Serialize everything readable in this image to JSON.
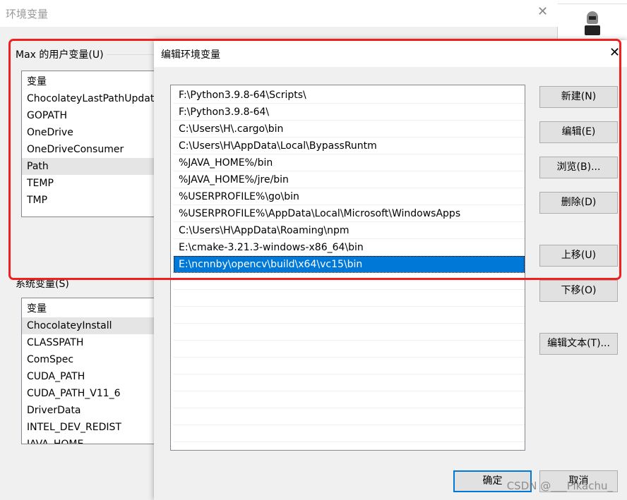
{
  "background_window": {
    "title": "环境变量",
    "user_group": "Max 的用户变量(U)",
    "user_header": "变量",
    "user_vars": [
      "ChocolateyLastPathUpdate",
      "GOPATH",
      "OneDrive",
      "OneDriveConsumer",
      "Path",
      "TEMP",
      "TMP"
    ],
    "system_group": "系统变量(S)",
    "system_header": "变量",
    "system_vars": [
      "ChocolateyInstall",
      "CLASSPATH",
      "ComSpec",
      "CUDA_PATH",
      "CUDA_PATH_V11_6",
      "DriverData",
      "INTEL_DEV_REDIST",
      "JAVA_HOME"
    ]
  },
  "dialog": {
    "title": "编辑环境变量",
    "paths": [
      "F:\\Python3.9.8-64\\Scripts\\",
      "F:\\Python3.9.8-64\\",
      "C:\\Users\\H\\.cargo\\bin",
      "C:\\Users\\H\\AppData\\Local\\BypassRuntm",
      "%JAVA_HOME%/bin",
      "%JAVA_HOME%/jre/bin",
      "%USERPROFILE%\\go\\bin",
      "%USERPROFILE%\\AppData\\Local\\Microsoft\\WindowsApps",
      "C:\\Users\\H\\AppData\\Roaming\\npm",
      "E:\\cmake-3.21.3-windows-x86_64\\bin",
      "E:\\ncnnby\\opencv\\build\\x64\\vc15\\bin"
    ],
    "selected_index": 10,
    "buttons": {
      "new": "新建(N)",
      "edit": "编辑(E)",
      "browse": "浏览(B)...",
      "delete": "删除(D)",
      "up": "上移(U)",
      "down": "下移(O)",
      "edit_text": "编辑文本(T)...",
      "ok": "确定",
      "cancel": "取消"
    }
  },
  "watermark": "CSDN @___Pikachu_",
  "colors": {
    "selection": "#0078d7",
    "highlight_box": "#f02020"
  }
}
